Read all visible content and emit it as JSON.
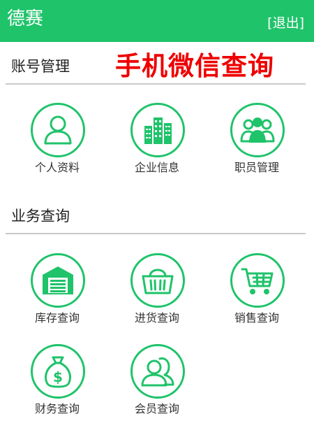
{
  "header": {
    "title": "德赛",
    "logout_label": "[退出]"
  },
  "banner_text": "手机微信查询",
  "sections": [
    {
      "title": "账号管理",
      "items": [
        {
          "label": "个人资料",
          "icon": "user-icon"
        },
        {
          "label": "企业信息",
          "icon": "buildings-icon"
        },
        {
          "label": "职员管理",
          "icon": "staff-group-icon"
        }
      ]
    },
    {
      "title": "业务查询",
      "items": [
        {
          "label": "库存查询",
          "icon": "warehouse-icon"
        },
        {
          "label": "进货查询",
          "icon": "basket-icon"
        },
        {
          "label": "销售查询",
          "icon": "shopping-cart-icon"
        },
        {
          "label": "财务查询",
          "icon": "money-bag-icon"
        },
        {
          "label": "会员查询",
          "icon": "member-icon"
        }
      ]
    }
  ],
  "colors": {
    "accent": "#1fc36a",
    "banner": "#ee0000",
    "divider": "#c9c9c9"
  }
}
